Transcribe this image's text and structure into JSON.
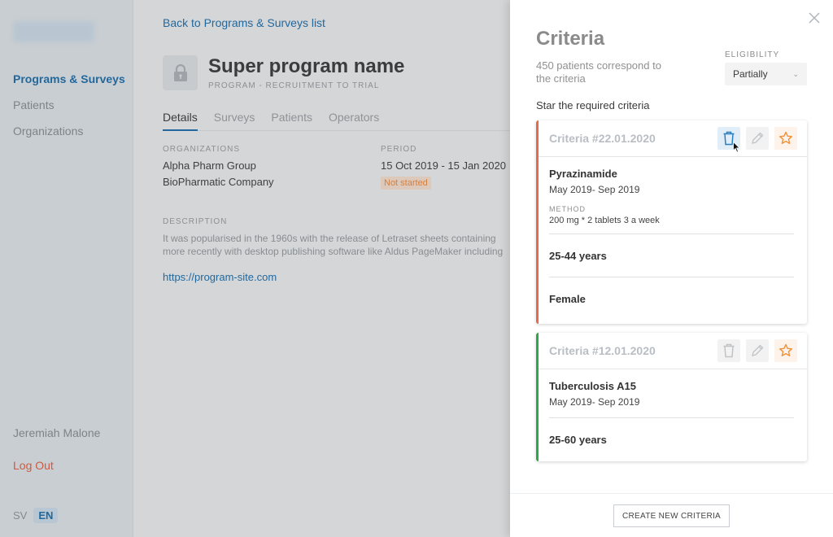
{
  "sidebar": {
    "nav": [
      {
        "label": "Programs & Surveys",
        "active": true
      },
      {
        "label": "Patients",
        "active": false
      },
      {
        "label": "Organizations",
        "active": false
      }
    ],
    "user_name": "Jeremiah Malone",
    "logout_label": "Log Out",
    "languages": [
      "SV",
      "EN"
    ],
    "active_language": "EN"
  },
  "main": {
    "back_link": "Back to Programs & Surveys list",
    "program": {
      "icon": "lock-icon",
      "title": "Super program name",
      "subtitle": "PROGRAM - RECRUITMENT TO TRIAL"
    },
    "tabs": [
      {
        "label": "Details",
        "active": true
      },
      {
        "label": "Surveys",
        "active": false
      },
      {
        "label": "Patients",
        "active": false
      },
      {
        "label": "Operators",
        "active": false
      }
    ],
    "organizations_label": "ORGANIZATIONS",
    "organizations": [
      "Alpha Pharm Group",
      "BioPharmatic Company"
    ],
    "period_label": "PERIOD",
    "period": "15 Oct 2019 - 15 Jan 2020",
    "status": "Not started",
    "description_label": "DESCRIPTION",
    "description_lines": [
      "It was popularised in the 1960s with the release of Letraset sheets containing",
      "more recently with desktop publishing software like Aldus PageMaker including"
    ],
    "site_link": "https://program-site.com"
  },
  "drawer": {
    "title": "Criteria",
    "patient_count_text": "450 patients correspond to the criteria",
    "eligibility_label": "ELIGIBILITY",
    "eligibility_value": "Partially",
    "star_hint": "Star the required criteria",
    "criteria": [
      {
        "title": "Criteria #22.01.2020",
        "accent_color": "#e8684a",
        "drug": "Pyrazinamide",
        "dates": "May 2019- Sep 2019",
        "method_label": "METHOD",
        "method": "200 mg * 2 tablets 3 a week",
        "age": "25-44 years",
        "gender": "Female"
      },
      {
        "title": "Criteria #12.01.2020",
        "accent_color": "#2aa84a",
        "drug": "Tuberculosis A15",
        "dates": "May 2019- Sep 2019",
        "age": "25-60 years"
      }
    ],
    "create_button": "CREATE NEW CRITERIA"
  },
  "colors": {
    "accent": "#23689c",
    "danger": "#cf5a40",
    "star": "#f0913a"
  }
}
